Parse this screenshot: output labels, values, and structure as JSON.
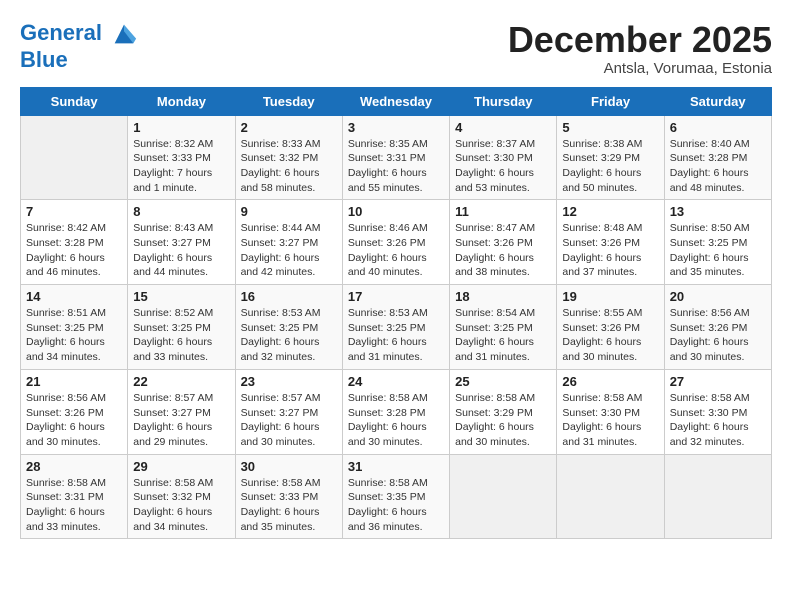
{
  "header": {
    "logo_line1": "General",
    "logo_line2": "Blue",
    "month": "December 2025",
    "location": "Antsla, Vorumaa, Estonia"
  },
  "days_of_week": [
    "Sunday",
    "Monday",
    "Tuesday",
    "Wednesday",
    "Thursday",
    "Friday",
    "Saturday"
  ],
  "weeks": [
    [
      {
        "day": "",
        "info": ""
      },
      {
        "day": "1",
        "info": "Sunrise: 8:32 AM\nSunset: 3:33 PM\nDaylight: 7 hours\nand 1 minute."
      },
      {
        "day": "2",
        "info": "Sunrise: 8:33 AM\nSunset: 3:32 PM\nDaylight: 6 hours\nand 58 minutes."
      },
      {
        "day": "3",
        "info": "Sunrise: 8:35 AM\nSunset: 3:31 PM\nDaylight: 6 hours\nand 55 minutes."
      },
      {
        "day": "4",
        "info": "Sunrise: 8:37 AM\nSunset: 3:30 PM\nDaylight: 6 hours\nand 53 minutes."
      },
      {
        "day": "5",
        "info": "Sunrise: 8:38 AM\nSunset: 3:29 PM\nDaylight: 6 hours\nand 50 minutes."
      },
      {
        "day": "6",
        "info": "Sunrise: 8:40 AM\nSunset: 3:28 PM\nDaylight: 6 hours\nand 48 minutes."
      }
    ],
    [
      {
        "day": "7",
        "info": "Sunrise: 8:42 AM\nSunset: 3:28 PM\nDaylight: 6 hours\nand 46 minutes."
      },
      {
        "day": "8",
        "info": "Sunrise: 8:43 AM\nSunset: 3:27 PM\nDaylight: 6 hours\nand 44 minutes."
      },
      {
        "day": "9",
        "info": "Sunrise: 8:44 AM\nSunset: 3:27 PM\nDaylight: 6 hours\nand 42 minutes."
      },
      {
        "day": "10",
        "info": "Sunrise: 8:46 AM\nSunset: 3:26 PM\nDaylight: 6 hours\nand 40 minutes."
      },
      {
        "day": "11",
        "info": "Sunrise: 8:47 AM\nSunset: 3:26 PM\nDaylight: 6 hours\nand 38 minutes."
      },
      {
        "day": "12",
        "info": "Sunrise: 8:48 AM\nSunset: 3:26 PM\nDaylight: 6 hours\nand 37 minutes."
      },
      {
        "day": "13",
        "info": "Sunrise: 8:50 AM\nSunset: 3:25 PM\nDaylight: 6 hours\nand 35 minutes."
      }
    ],
    [
      {
        "day": "14",
        "info": "Sunrise: 8:51 AM\nSunset: 3:25 PM\nDaylight: 6 hours\nand 34 minutes."
      },
      {
        "day": "15",
        "info": "Sunrise: 8:52 AM\nSunset: 3:25 PM\nDaylight: 6 hours\nand 33 minutes."
      },
      {
        "day": "16",
        "info": "Sunrise: 8:53 AM\nSunset: 3:25 PM\nDaylight: 6 hours\nand 32 minutes."
      },
      {
        "day": "17",
        "info": "Sunrise: 8:53 AM\nSunset: 3:25 PM\nDaylight: 6 hours\nand 31 minutes."
      },
      {
        "day": "18",
        "info": "Sunrise: 8:54 AM\nSunset: 3:25 PM\nDaylight: 6 hours\nand 31 minutes."
      },
      {
        "day": "19",
        "info": "Sunrise: 8:55 AM\nSunset: 3:26 PM\nDaylight: 6 hours\nand 30 minutes."
      },
      {
        "day": "20",
        "info": "Sunrise: 8:56 AM\nSunset: 3:26 PM\nDaylight: 6 hours\nand 30 minutes."
      }
    ],
    [
      {
        "day": "21",
        "info": "Sunrise: 8:56 AM\nSunset: 3:26 PM\nDaylight: 6 hours\nand 30 minutes."
      },
      {
        "day": "22",
        "info": "Sunrise: 8:57 AM\nSunset: 3:27 PM\nDaylight: 6 hours\nand 29 minutes."
      },
      {
        "day": "23",
        "info": "Sunrise: 8:57 AM\nSunset: 3:27 PM\nDaylight: 6 hours\nand 30 minutes."
      },
      {
        "day": "24",
        "info": "Sunrise: 8:58 AM\nSunset: 3:28 PM\nDaylight: 6 hours\nand 30 minutes."
      },
      {
        "day": "25",
        "info": "Sunrise: 8:58 AM\nSunset: 3:29 PM\nDaylight: 6 hours\nand 30 minutes."
      },
      {
        "day": "26",
        "info": "Sunrise: 8:58 AM\nSunset: 3:30 PM\nDaylight: 6 hours\nand 31 minutes."
      },
      {
        "day": "27",
        "info": "Sunrise: 8:58 AM\nSunset: 3:30 PM\nDaylight: 6 hours\nand 32 minutes."
      }
    ],
    [
      {
        "day": "28",
        "info": "Sunrise: 8:58 AM\nSunset: 3:31 PM\nDaylight: 6 hours\nand 33 minutes."
      },
      {
        "day": "29",
        "info": "Sunrise: 8:58 AM\nSunset: 3:32 PM\nDaylight: 6 hours\nand 34 minutes."
      },
      {
        "day": "30",
        "info": "Sunrise: 8:58 AM\nSunset: 3:33 PM\nDaylight: 6 hours\nand 35 minutes."
      },
      {
        "day": "31",
        "info": "Sunrise: 8:58 AM\nSunset: 3:35 PM\nDaylight: 6 hours\nand 36 minutes."
      },
      {
        "day": "",
        "info": ""
      },
      {
        "day": "",
        "info": ""
      },
      {
        "day": "",
        "info": ""
      }
    ]
  ]
}
